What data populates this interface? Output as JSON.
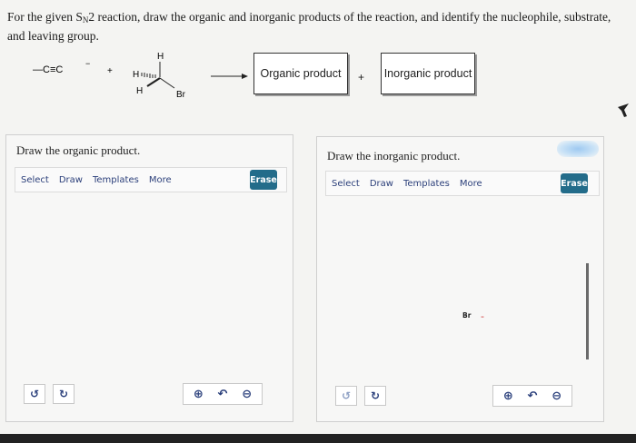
{
  "question": {
    "text_before": "For the given S",
    "subscript": "N",
    "text_after": "2 reaction, draw the organic and inorganic products of the reaction, and identify the nucleophile, substrate, and leaving group."
  },
  "scheme": {
    "nucleophile": "—C≡C",
    "charge": "−",
    "plus": "+",
    "substrate_h_top": "H",
    "substrate_h_left": "H",
    "substrate_h_bottom": "H",
    "substrate_br": "Br",
    "organic_product_label": "Organic product",
    "plus2": "+",
    "inorganic_product_label": "Inorganic product"
  },
  "left_panel": {
    "title": "Draw the organic product.",
    "toolbar": [
      "Select",
      "Draw",
      "Templates",
      "More"
    ],
    "erase": "Erase",
    "undo_icon": "undo-icon",
    "redo_icon": "redo-icon",
    "zoom_in_icon": "zoom-in-icon",
    "reset_icon": "reset-zoom-icon",
    "zoom_out_icon": "zoom-out-icon"
  },
  "right_panel": {
    "title": "Draw the inorganic product.",
    "toolbar": [
      "Select",
      "Draw",
      "Templates",
      "More"
    ],
    "erase": "Erase",
    "canvas_atom": "Br",
    "canvas_charge": "-"
  },
  "colors": {
    "erase_bg": "#236c8a",
    "toolbar_text": "#2b3f7a",
    "charge": "#d23b3b"
  }
}
